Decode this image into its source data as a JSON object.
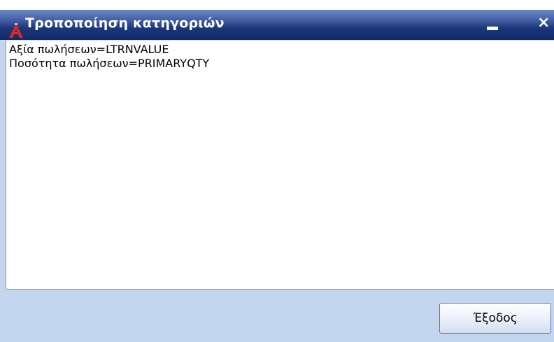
{
  "window": {
    "title": "Τροποποίηση κατηγοριών",
    "minimize_icon": "minimize-icon",
    "close_label": "×"
  },
  "memo": {
    "lines": [
      "Αξία πωλήσεων=LTRNVALUE",
      "Ποσότητα πωλήσεων=PRIMARYQTY"
    ]
  },
  "buttons": {
    "exit_label": "Έξοδος"
  },
  "colors": {
    "titlebar": "#1c3578",
    "client_background": "#c4d6ee",
    "memo_background": "#ffffff",
    "icon_red": "#e0281c"
  }
}
